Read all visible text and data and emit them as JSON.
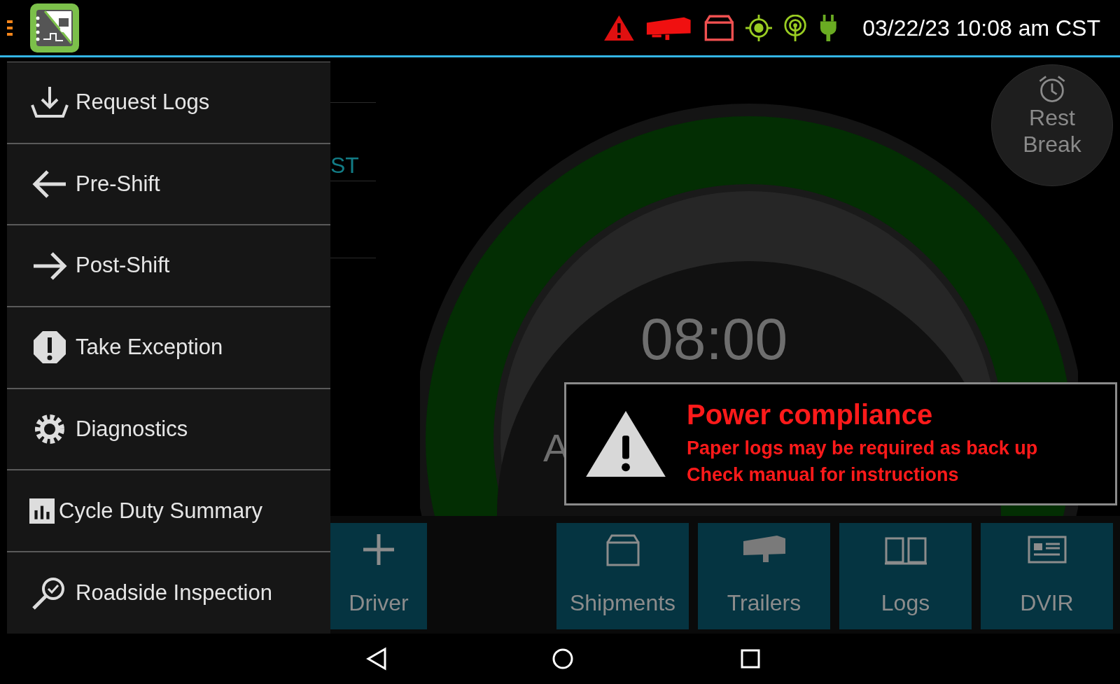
{
  "status_bar": {
    "datetime": "03/22/23 10:08 am CST"
  },
  "drawer": {
    "items": [
      {
        "label": "Request Logs",
        "kind": "download"
      },
      {
        "label": "Pre-Shift",
        "kind": "left"
      },
      {
        "label": "Post-Shift",
        "kind": "right"
      },
      {
        "label": "Take Exception",
        "kind": "exclaim"
      },
      {
        "label": "Diagnostics",
        "kind": "gear"
      },
      {
        "label": "Cycle Duty Summary",
        "kind": "chart"
      },
      {
        "label": "Roadside Inspection",
        "kind": "inspect"
      }
    ]
  },
  "dashboard": {
    "partial_label": "ST",
    "clock_label": "A",
    "remaining_time": "08:00",
    "rest_break": "Rest Break",
    "actions": [
      {
        "label": "Driver",
        "kind": "add"
      },
      {
        "label": "Shipments",
        "kind": "box"
      },
      {
        "label": "Trailers",
        "kind": "trailer"
      },
      {
        "label": "Logs",
        "kind": "book"
      },
      {
        "label": "DVIR",
        "kind": "report"
      }
    ]
  },
  "alert": {
    "title": "Power compliance",
    "lines": [
      "Paper logs may be required as back up",
      "Check manual for instructions"
    ]
  }
}
